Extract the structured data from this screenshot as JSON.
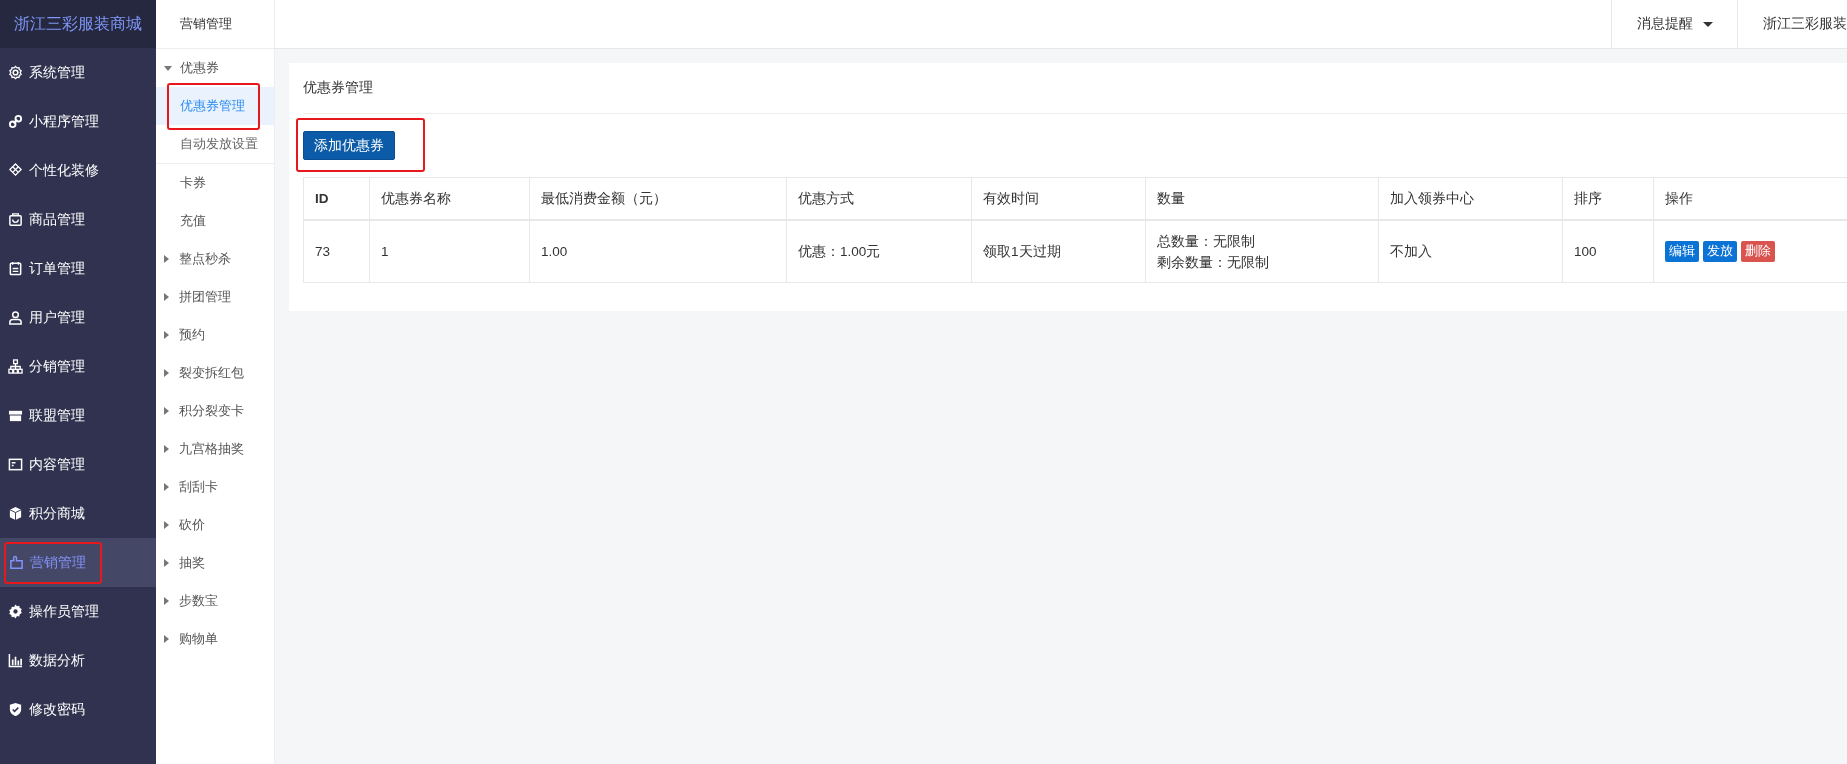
{
  "logo": "浙江三彩服装商城",
  "menu": [
    {
      "label": "系统管理",
      "selected": false,
      "highlighted": false
    },
    {
      "label": "小程序管理",
      "selected": false,
      "highlighted": false
    },
    {
      "label": "个性化装修",
      "selected": false,
      "highlighted": false
    },
    {
      "label": "商品管理",
      "selected": false,
      "highlighted": false
    },
    {
      "label": "订单管理",
      "selected": false,
      "highlighted": false
    },
    {
      "label": "用户管理",
      "selected": false,
      "highlighted": false
    },
    {
      "label": "分销管理",
      "selected": false,
      "highlighted": false
    },
    {
      "label": "联盟管理",
      "selected": false,
      "highlighted": false
    },
    {
      "label": "内容管理",
      "selected": false,
      "highlighted": false
    },
    {
      "label": "积分商城",
      "selected": false,
      "highlighted": false
    },
    {
      "label": "营销管理",
      "selected": true,
      "highlighted": true
    },
    {
      "label": "操作员管理",
      "selected": false,
      "highlighted": false
    },
    {
      "label": "数据分析",
      "selected": false,
      "highlighted": false
    },
    {
      "label": "修改密码",
      "selected": false,
      "highlighted": false
    }
  ],
  "submenu": {
    "title": "营销管理",
    "items": [
      {
        "kind": "group",
        "label": "优惠券",
        "expanded": true,
        "children": [
          {
            "label": "优惠券管理",
            "selected": true,
            "highlighted": true
          },
          {
            "label": "自动发放设置",
            "selected": false,
            "highlighted": false
          }
        ]
      },
      {
        "kind": "link",
        "label": "卡券"
      },
      {
        "kind": "link",
        "label": "充值"
      },
      {
        "kind": "group",
        "label": "整点秒杀",
        "expanded": false
      },
      {
        "kind": "group",
        "label": "拼团管理",
        "expanded": false
      },
      {
        "kind": "group",
        "label": "预约",
        "expanded": false
      },
      {
        "kind": "group",
        "label": "裂变拆红包",
        "expanded": false
      },
      {
        "kind": "group",
        "label": "积分裂变卡",
        "expanded": false
      },
      {
        "kind": "group",
        "label": "九宫格抽奖",
        "expanded": false
      },
      {
        "kind": "group",
        "label": "刮刮卡",
        "expanded": false
      },
      {
        "kind": "group",
        "label": "砍价",
        "expanded": false
      },
      {
        "kind": "group",
        "label": "抽奖",
        "expanded": false
      },
      {
        "kind": "group",
        "label": "步数宝",
        "expanded": false
      },
      {
        "kind": "group",
        "label": "购物单",
        "expanded": false
      }
    ]
  },
  "topbar": {
    "items": [
      {
        "label": "消息提醒",
        "dropdown": true
      },
      {
        "label": "浙江三彩服装",
        "dropdown": false
      }
    ]
  },
  "card": {
    "title": "优惠券管理",
    "add_button": {
      "label": "添加优惠券",
      "highlighted": true
    },
    "table": {
      "columns": [
        "ID",
        "优惠券名称",
        "最低消费金额（元）",
        "优惠方式",
        "有效时间",
        "数量",
        "加入领券中心",
        "排序",
        "操作"
      ],
      "rows": [
        {
          "cells": [
            "73",
            "1",
            "1.00",
            "优惠：1.00元",
            "领取1天过期",
            [
              "总数量：无限制",
              "剩余数量：无限制"
            ],
            "不加入",
            "100"
          ],
          "actions": [
            {
              "label": "编辑",
              "kind": "primary"
            },
            {
              "label": "发放",
              "kind": "primary"
            },
            {
              "label": "删除",
              "kind": "danger"
            }
          ]
        }
      ]
    }
  }
}
